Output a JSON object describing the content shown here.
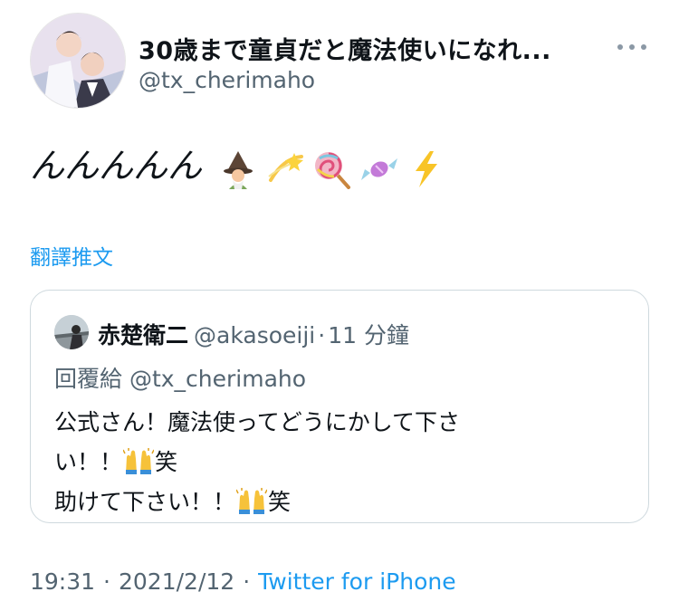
{
  "tweet": {
    "author": {
      "display_name": "30歳まで童貞だと魔法使いになれ...",
      "handle": "@tx_cherimaho"
    },
    "text": "んんんんん",
    "emojis": [
      "mage-emoji",
      "dizzy-emoji",
      "lollipop-emoji",
      "candy-emoji",
      "zap-emoji"
    ],
    "translate_label": "翻譯推文",
    "quoted": {
      "display_name": "赤楚衛二",
      "handle": "@akasoeiji",
      "separator": "·",
      "time": "11 分鐘",
      "reply_to": "回覆給 @tx_cherimaho",
      "lines": [
        {
          "text": "公式さん！魔法使ってどうにかして下さ",
          "suffix": ""
        },
        {
          "text": "い！！",
          "suffix": "笑"
        },
        {
          "text": "助けて下さい！！",
          "suffix": "笑"
        }
      ]
    },
    "meta": {
      "time": "19:31",
      "date": "2021/2/12",
      "separator": "·",
      "source": "Twitter for iPhone"
    }
  },
  "colors": {
    "link": "#1d9bf0",
    "secondary": "#536471",
    "border": "#cfd9de"
  }
}
